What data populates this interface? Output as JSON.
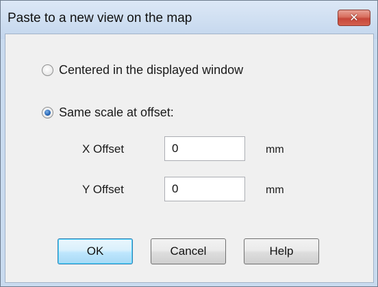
{
  "window": {
    "title": "Paste to a new view on the map",
    "close_glyph": "✕"
  },
  "options": {
    "centered_label": "Centered in the displayed window",
    "centered_selected": false,
    "same_scale_label": "Same scale at offset:",
    "same_scale_selected": true
  },
  "x_offset": {
    "label": "X Offset",
    "value": "0",
    "unit": "mm"
  },
  "y_offset": {
    "label": "Y Offset",
    "value": "0",
    "unit": "mm"
  },
  "buttons": {
    "ok": "OK",
    "cancel": "Cancel",
    "help": "Help"
  }
}
